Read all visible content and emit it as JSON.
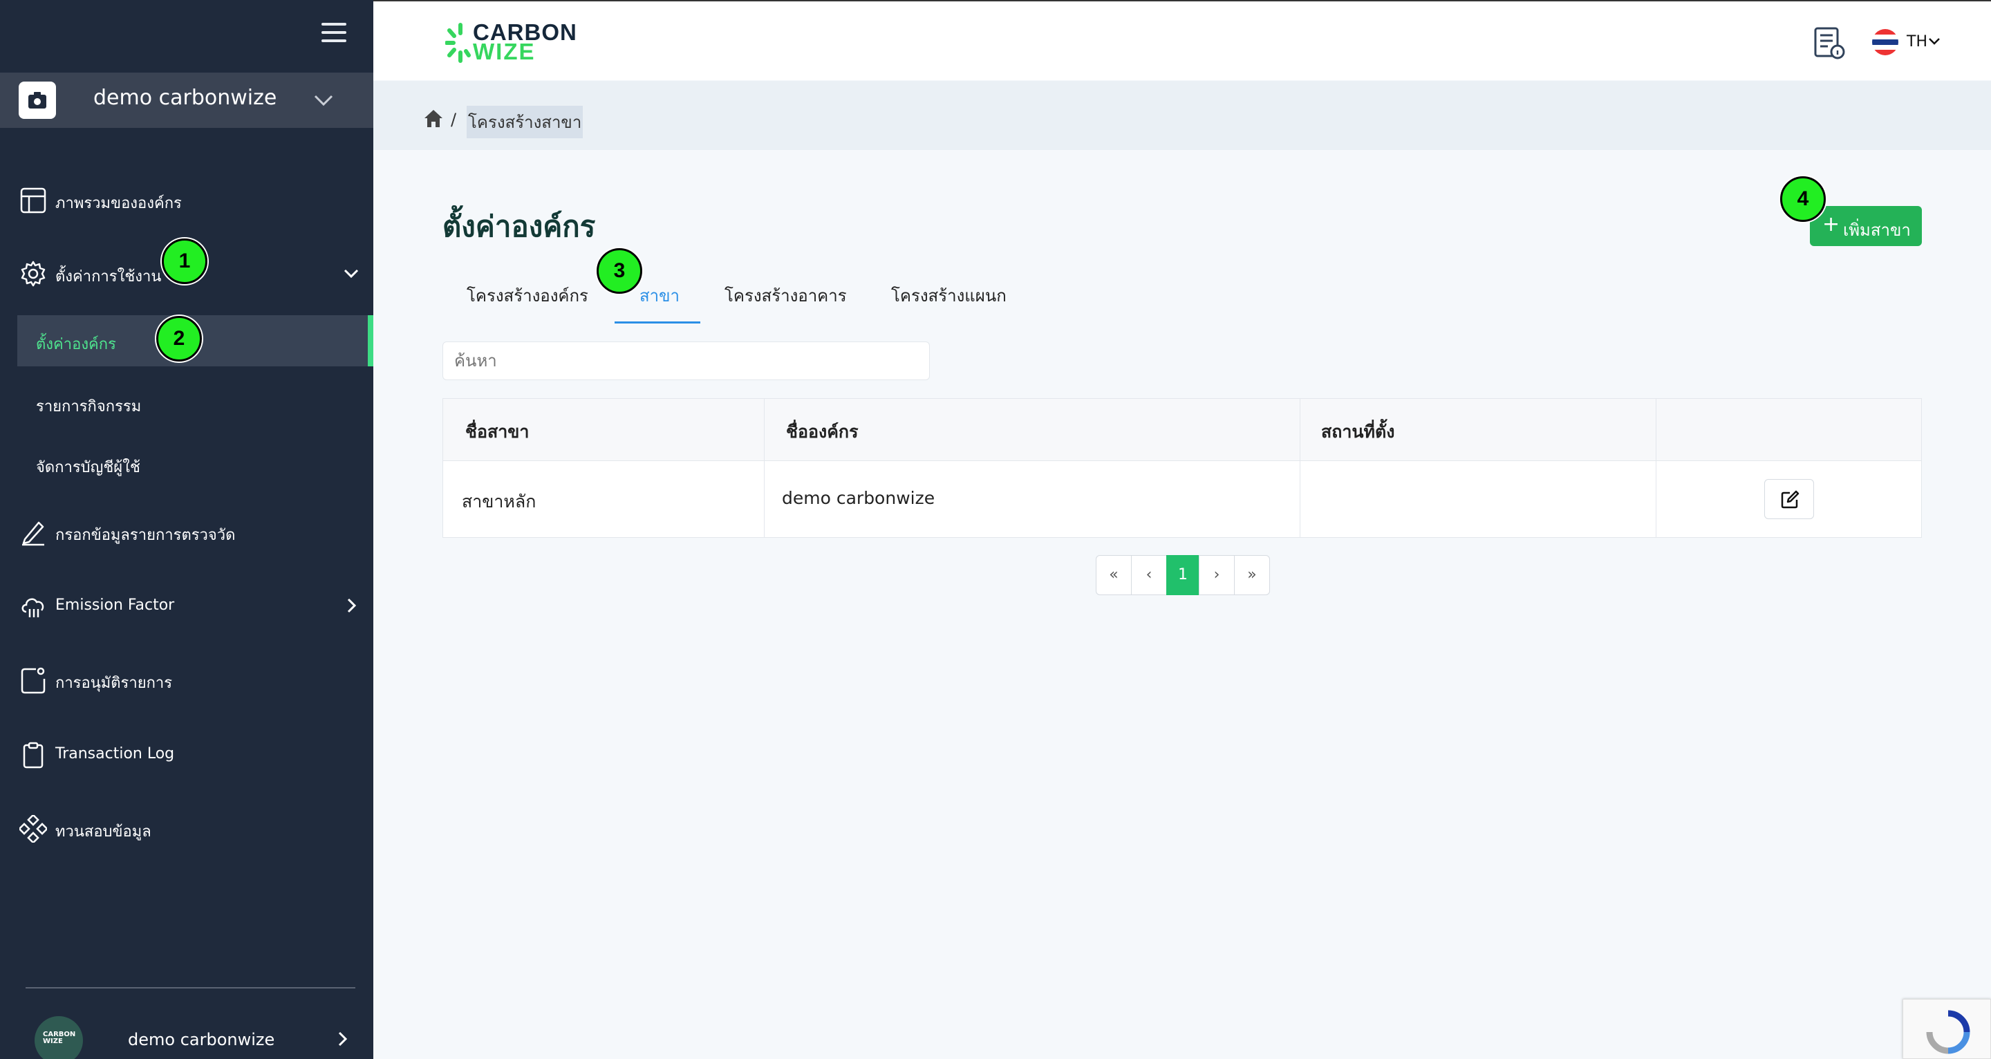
{
  "sidebar": {
    "org_name": "demo carbonwize",
    "items": [
      {
        "label": "ภาพรวมขององค์กร",
        "icon": "layout-icon"
      },
      {
        "label": "ตั้งค่าการใช้งาน",
        "icon": "gear-icon"
      },
      {
        "label": "กรอกข้อมูลรายการตรวจวัด",
        "icon": "pencil-icon"
      },
      {
        "label": "Emission Factor",
        "icon": "cloud-icon"
      },
      {
        "label": "การอนุมัติรายการ",
        "icon": "approval-icon"
      },
      {
        "label": "Transaction Log",
        "icon": "clipboard-icon"
      },
      {
        "label": "ทวนสอบข้อมูล",
        "icon": "diamond-grid-icon"
      }
    ],
    "sub_items": [
      {
        "label": "ตั้งค่าองค์กร",
        "active": true
      },
      {
        "label": "รายการกิจกรรม",
        "active": false
      },
      {
        "label": "จัดการบัญชีผู้ใช้",
        "active": false
      }
    ],
    "user": {
      "name": "demo carbonwize",
      "avatar_text": "CARBON WIZE"
    }
  },
  "header": {
    "brand_line1": "CARBON",
    "brand_line2": "WIZE",
    "language": "TH"
  },
  "breadcrumb": {
    "separator": "/",
    "current": "โครงสร้างสาขา"
  },
  "page": {
    "title": "ตั้งค่าองค์กร",
    "add_button_label": "เพิ่มสาขา",
    "tabs": [
      {
        "label": "โครงสร้างองค์กร",
        "active": false
      },
      {
        "label": "สาขา",
        "active": true
      },
      {
        "label": "โครงสร้างอาคาร",
        "active": false
      },
      {
        "label": "โครงสร้างแผนก",
        "active": false
      }
    ],
    "search_placeholder": "ค้นหา"
  },
  "table": {
    "columns": [
      "ชื่อสาขา",
      "ชื่อองค์กร",
      "สถานที่ตั้ง",
      ""
    ],
    "rows": [
      {
        "branch_name": "สาขาหลัก",
        "org_name": "demo carbonwize",
        "location": ""
      }
    ]
  },
  "pagination": {
    "first": "«",
    "prev": "‹",
    "current": "1",
    "next": "›",
    "last": "»"
  },
  "markers": [
    "1",
    "2",
    "3",
    "4"
  ],
  "colors": {
    "sidebar_bg": "#1f2a3c",
    "accent_green": "#24b257",
    "tab_active": "#2b8fe6"
  }
}
